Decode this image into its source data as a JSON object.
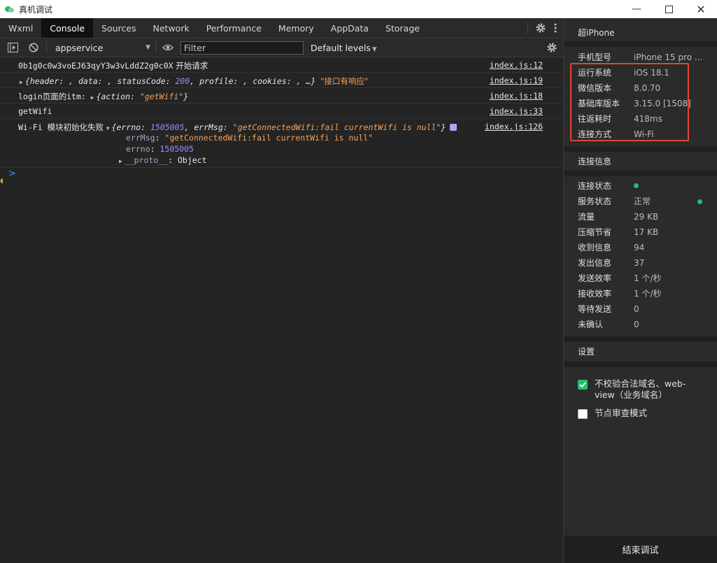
{
  "window": {
    "title": "真机调试"
  },
  "tabs": [
    "Wxml",
    "Console",
    "Sources",
    "Network",
    "Performance",
    "Memory",
    "AppData",
    "Storage"
  ],
  "toolbar": {
    "context": "appservice",
    "filter_placeholder": "Filter",
    "levels": "Default levels"
  },
  "logs": {
    "l1": {
      "text": "0b1g0c0w3voEJ63qyY3w3vLddZ2g0c0X",
      "cjk": " 开始请求",
      "src": "index.js:12"
    },
    "l2": {
      "a": "{header: , data: , statusCode: ",
      "code": "200",
      "b": ", profile: , cookies: , …} ",
      "msg": "\"接口有响应\"",
      "src": "index.js:19"
    },
    "l3": {
      "prefix": "login",
      "cjk": "页面的",
      "suffix": "itm: ",
      "obj_a": "{action: ",
      "obj_val": "\"getWifi\"",
      "obj_b": "}",
      "src": "index.js:18"
    },
    "l4": {
      "text": "getWifi",
      "src": "index.js:33"
    },
    "l5": {
      "prefix": "Wi-Fi ",
      "cjk": "模块初始化失败 ",
      "obj_a": "{errno: ",
      "errno": "1505005",
      "obj_b": ", errMsg: ",
      "errmsg": "\"getConnectedWifi:fail currentWifi is null\"",
      "obj_c": "}",
      "src": "index.js:126",
      "rows": {
        "errmsg_key": "errMsg",
        "errmsg_val": "\"getConnectedWifi:fail currentWifi is null\"",
        "errno_key": "errno",
        "errno_val": "1505005",
        "proto_key": "__proto__",
        "proto_val": ": Object"
      }
    }
  },
  "prompt": ">",
  "device": {
    "name": "超iPhone",
    "items": [
      {
        "k": "手机型号",
        "v": "iPhone 15 pro m..."
      },
      {
        "k": "运行系统",
        "v": "iOS 18.1"
      },
      {
        "k": "微信版本",
        "v": "8.0.70"
      },
      {
        "k": "基础库版本",
        "v": "3.15.0 [1508]"
      },
      {
        "k": "往返耗时",
        "v": "418ms"
      },
      {
        "k": "连接方式",
        "v": "Wi-Fi"
      }
    ]
  },
  "connection": {
    "title": "连接信息",
    "items": [
      {
        "k": "连接状态",
        "v": ""
      },
      {
        "k": "服务状态",
        "v": "正常"
      },
      {
        "k": "流量",
        "v": "29 KB"
      },
      {
        "k": "压缩节省",
        "v": "17 KB"
      },
      {
        "k": "收到信息",
        "v": "94"
      },
      {
        "k": "发出信息",
        "v": "37"
      },
      {
        "k": "发送效率",
        "v": "1 个/秒"
      },
      {
        "k": "接收效率",
        "v": "1 个/秒"
      },
      {
        "k": "等待发送",
        "v": "0"
      },
      {
        "k": "未确认",
        "v": "0"
      }
    ]
  },
  "settings": {
    "title": "设置",
    "options": [
      {
        "label": "不校验合法域名、web-view（业务域名）",
        "checked": true
      },
      {
        "label": "节点审查模式",
        "checked": false
      }
    ]
  },
  "end_button": "结束调试",
  "colors": {
    "accent_green": "#1ec26a",
    "highlight_red": "#e0463a",
    "number": "#9d8cf7",
    "string": "#f0a35c"
  }
}
